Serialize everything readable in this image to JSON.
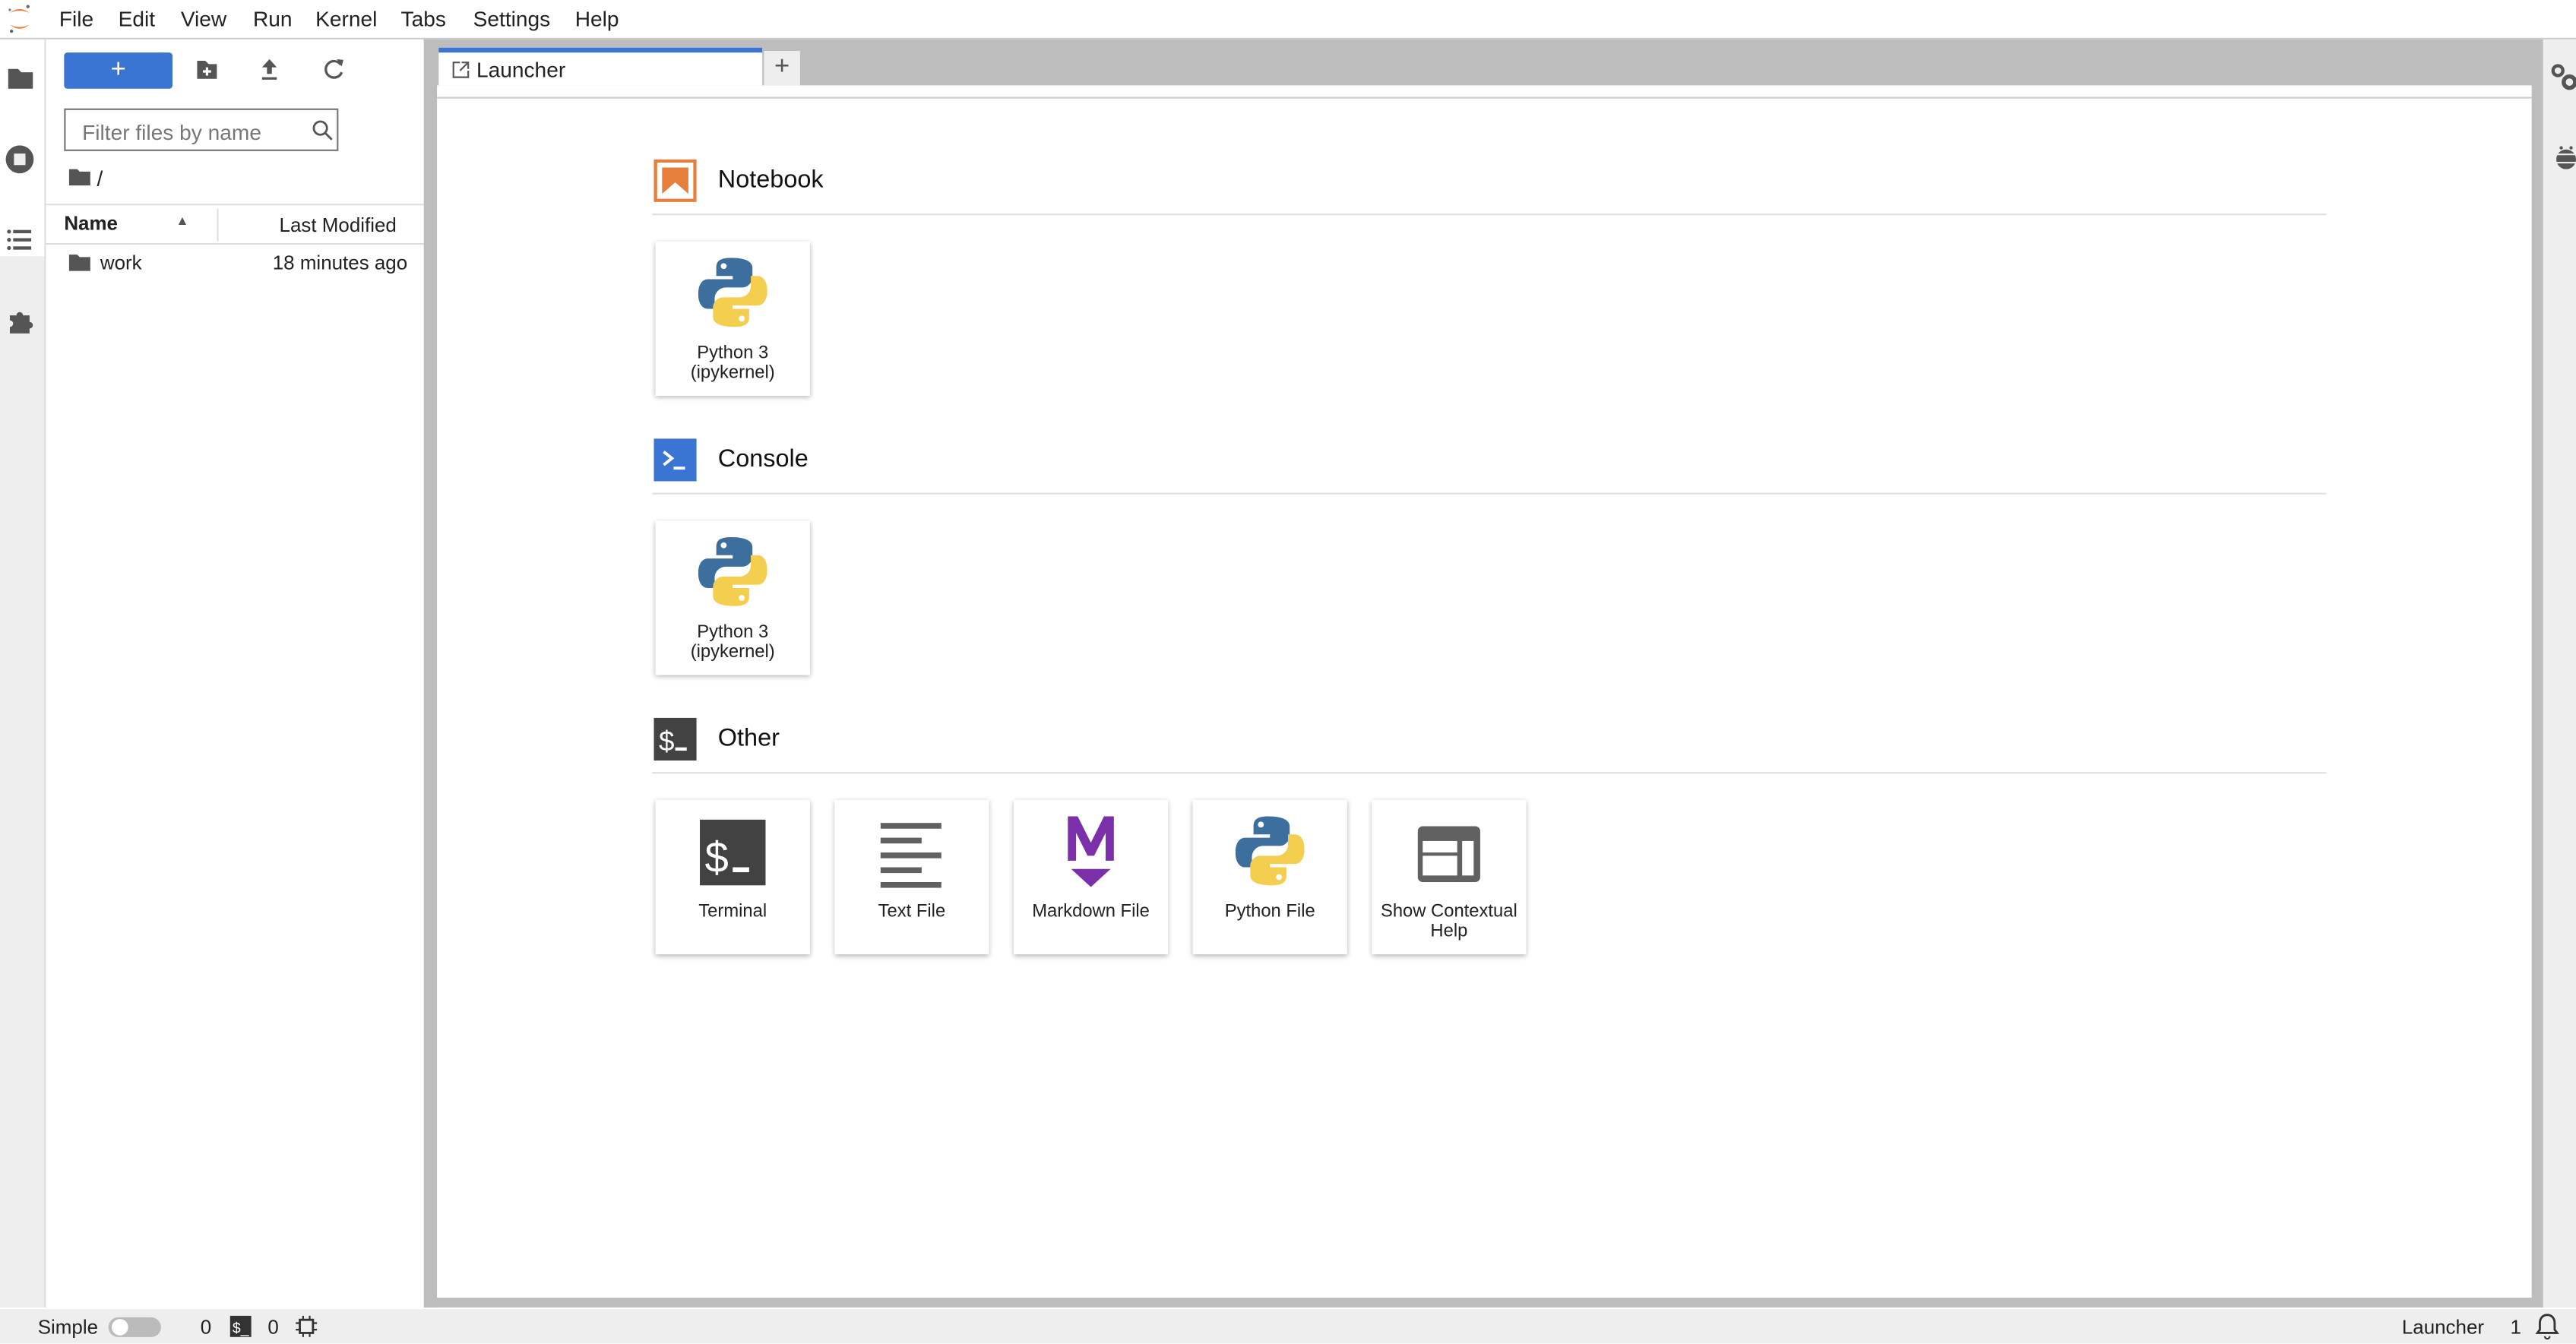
{
  "menubar": {
    "items": [
      "File",
      "Edit",
      "View",
      "Run",
      "Kernel",
      "Tabs",
      "Settings",
      "Help"
    ]
  },
  "filebrowser": {
    "new_label": "+",
    "filter_placeholder": "Filter files by name",
    "path": "/",
    "columns": {
      "name": "Name",
      "modified": "Last Modified"
    },
    "sort_indicator": "ascending",
    "rows": [
      {
        "name": "work",
        "modified": "18 minutes ago",
        "type": "folder"
      }
    ]
  },
  "tabs": [
    {
      "label": "Launcher",
      "active": true
    }
  ],
  "tab_add_label": "+",
  "launcher": {
    "sections": [
      {
        "title": "Notebook",
        "icon": "notebook-icon",
        "cards": [
          {
            "label": "Python 3 (ipykernel)",
            "icon": "python-icon"
          }
        ]
      },
      {
        "title": "Console",
        "icon": "console-icon",
        "cards": [
          {
            "label": "Python 3 (ipykernel)",
            "icon": "python-icon"
          }
        ]
      },
      {
        "title": "Other",
        "icon": "terminal-icon",
        "cards": [
          {
            "label": "Terminal",
            "icon": "terminal-icon"
          },
          {
            "label": "Text File",
            "icon": "text-file-icon"
          },
          {
            "label": "Markdown File",
            "icon": "markdown-icon"
          },
          {
            "label": "Python File",
            "icon": "python-icon"
          },
          {
            "label": "Show Contextual Help",
            "icon": "contextual-help-icon"
          }
        ]
      }
    ]
  },
  "statusbar": {
    "mode_label": "Simple",
    "simple_mode": false,
    "terminals": "0",
    "kernels": "0",
    "active_tab": "Launcher",
    "notifications": "1"
  },
  "colors": {
    "accent": "#3a75d4",
    "notebook": "#e67e3c",
    "markdown": "#7b2fa8",
    "python_blue": "#3d6f9e",
    "python_yellow": "#f4cf4f"
  }
}
